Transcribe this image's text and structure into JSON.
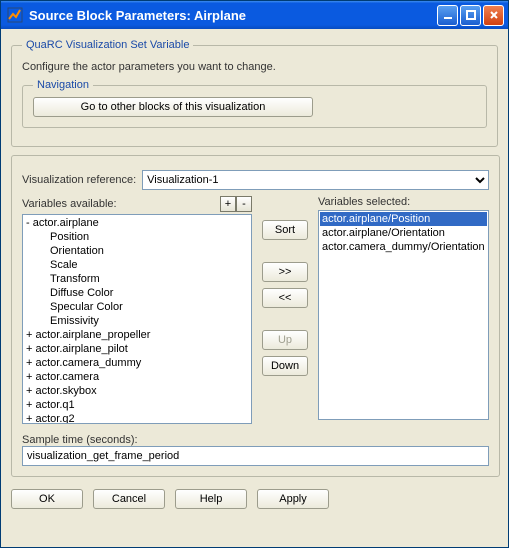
{
  "window": {
    "title": "Source Block Parameters: Airplane",
    "icon": "matlab-icon"
  },
  "group1": {
    "legend": "QuaRC Visualization Set Variable",
    "desc": "Configure the actor parameters you want to change."
  },
  "navGroup": {
    "legend": "Navigation",
    "goto": "Go to other blocks of this visualization"
  },
  "visref": {
    "label": "Visualization reference:",
    "value": "Visualization-1",
    "options": [
      "Visualization-1"
    ]
  },
  "available": {
    "label": "Variables available:",
    "plus": "+",
    "minus": "-",
    "items": [
      {
        "text": "actor.airplane",
        "cls": "parent"
      },
      {
        "text": "Position",
        "cls": "child"
      },
      {
        "text": "Orientation",
        "cls": "child"
      },
      {
        "text": "Scale",
        "cls": "child"
      },
      {
        "text": "Transform",
        "cls": "child"
      },
      {
        "text": "Diffuse Color",
        "cls": "child"
      },
      {
        "text": "Specular Color",
        "cls": "child"
      },
      {
        "text": "Emissivity",
        "cls": "child"
      },
      {
        "text": "actor.airplane_propeller",
        "cls": "collapsed"
      },
      {
        "text": "actor.airplane_pilot",
        "cls": "collapsed"
      },
      {
        "text": "actor.camera_dummy",
        "cls": "collapsed"
      },
      {
        "text": "actor.camera",
        "cls": "collapsed"
      },
      {
        "text": "actor.skybox",
        "cls": "collapsed"
      },
      {
        "text": "actor.q1",
        "cls": "collapsed"
      },
      {
        "text": "actor.q2",
        "cls": "collapsed"
      }
    ]
  },
  "selected": {
    "label": "Variables selected:",
    "items": [
      {
        "text": "actor.airplane/Position",
        "sel": true
      },
      {
        "text": "actor.airplane/Orientation",
        "sel": false
      },
      {
        "text": "actor.camera_dummy/Orientation",
        "sel": false
      }
    ]
  },
  "mid": {
    "sort": "Sort",
    "addall": ">>",
    "removeall": "<<",
    "up": "Up",
    "down": "Down"
  },
  "sample": {
    "label": "Sample time (seconds):",
    "value": "visualization_get_frame_period"
  },
  "footer": {
    "ok": "OK",
    "cancel": "Cancel",
    "help": "Help",
    "apply": "Apply"
  }
}
